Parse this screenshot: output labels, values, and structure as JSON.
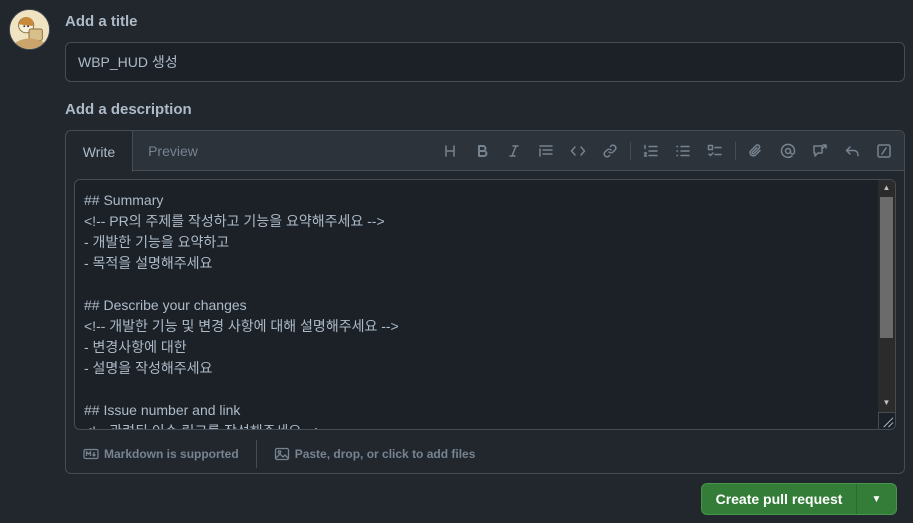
{
  "avatar": {
    "alt": "user avatar"
  },
  "title_section": {
    "label": "Add a title",
    "value": "WBP_HUD 생성"
  },
  "description_section": {
    "label": "Add a description",
    "tabs": [
      "Write",
      "Preview"
    ],
    "toolbar_icons": [
      "heading-icon",
      "bold-icon",
      "italic-icon",
      "quote-icon",
      "code-icon",
      "link-icon",
      "numbered-list-icon",
      "unordered-list-icon",
      "task-list-icon",
      "attach-icon",
      "mention-icon",
      "cross-reference-icon",
      "reply-icon",
      "slash-command-icon"
    ],
    "body_text": "## Summary\n<!-- PR의 주제를 작성하고 기능을 요약해주세요 -->\n- 개발한 기능을 요약하고\n- 목적을 설명해주세요\n\n## Describe your changes\n<!-- 개발한 기능 및 변경 사항에 대해 설명해주세요 -->\n- 변경사항에 대한\n- 설명을 작성해주세요\n\n## Issue number and link\n<!-- 관련된 이슈 링크를 작성해주세요 -->",
    "footer": {
      "markdown_label": "Markdown is supported",
      "attach_label": "Paste, drop, or click to add files"
    }
  },
  "submit": {
    "label": "Create pull request",
    "color": "#347d39"
  }
}
